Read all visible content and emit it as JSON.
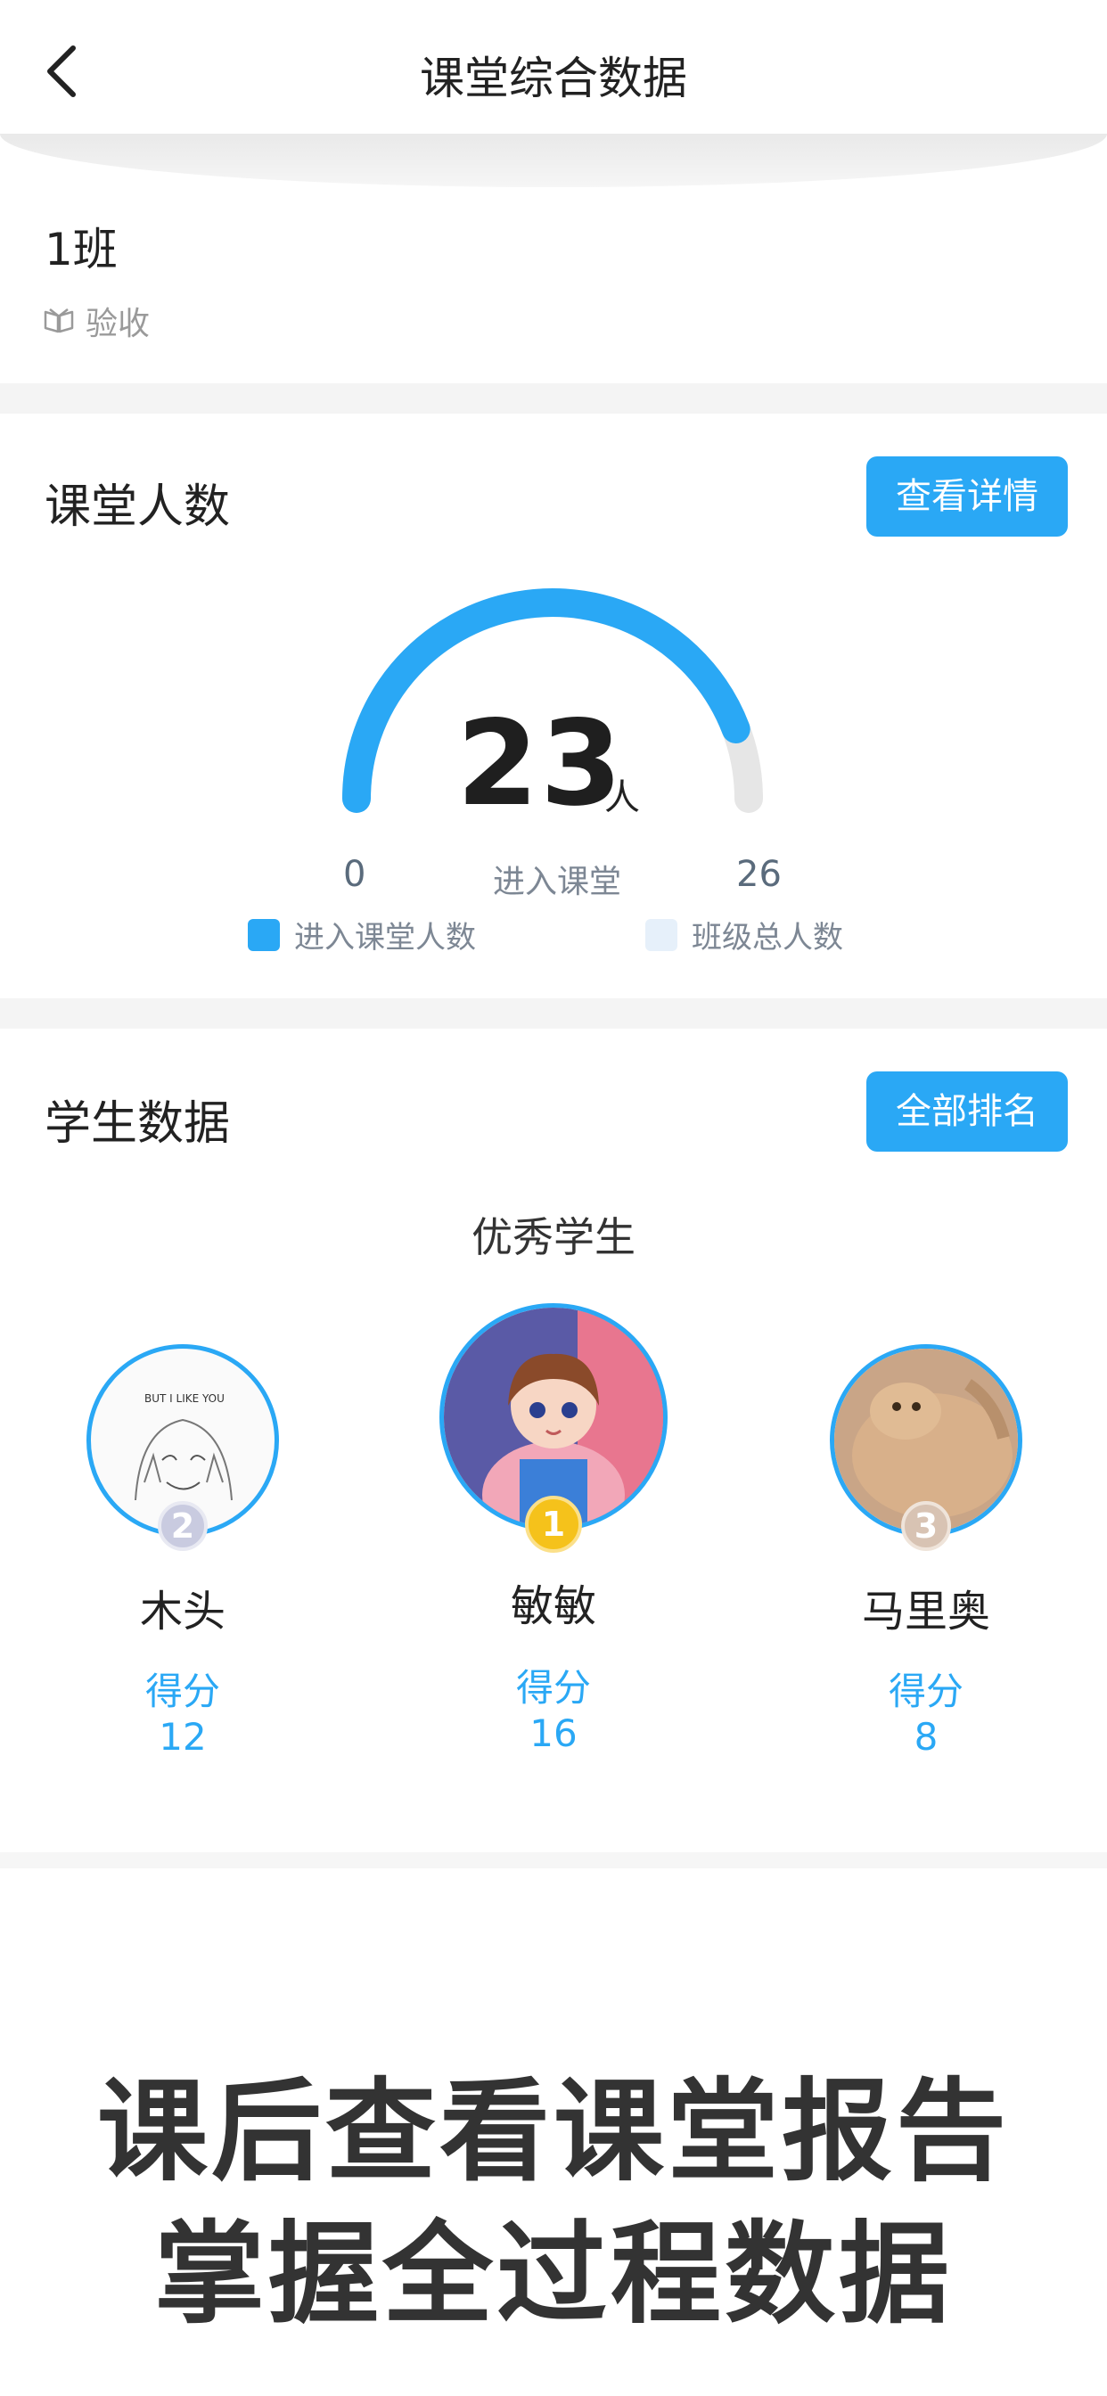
{
  "header": {
    "title": "课堂综合数据",
    "back_icon": "chevron-left-icon"
  },
  "class_card": {
    "name": "1班",
    "status_icon": "book-icon",
    "status": "验收"
  },
  "attendance": {
    "title": "课堂人数",
    "detail_button": "查看详情",
    "count": "23",
    "unit": "人",
    "min_label": "0",
    "center_label": "进入课堂",
    "max_label": "26",
    "entered_value": 23,
    "total_value": 26,
    "legend": [
      {
        "label": "进入课堂人数",
        "color": "#2aa8f5"
      },
      {
        "label": "班级总人数",
        "color": "#e6f0fa"
      }
    ]
  },
  "students": {
    "title": "学生数据",
    "ranking_button": "全部排名",
    "subtitle": "优秀学生",
    "top": [
      {
        "rank": "2",
        "name": "木头",
        "score_label": "得分",
        "score": "12"
      },
      {
        "rank": "1",
        "name": "敏敏",
        "score_label": "得分",
        "score": "16"
      },
      {
        "rank": "3",
        "name": "马里奥",
        "score_label": "得分",
        "score": "8"
      }
    ]
  },
  "promo": {
    "line1": "课后查看课堂报告",
    "line2": "掌握全过程数据"
  },
  "colors": {
    "accent": "#2aa8f5",
    "track": "#e6e6e6",
    "gold": "#f5c21b",
    "silver": "#c9cbe0",
    "bronze": "#d8c3b3"
  }
}
